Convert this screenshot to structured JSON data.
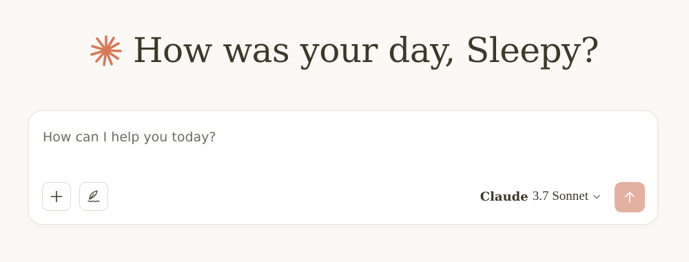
{
  "greeting": {
    "text": "How was your day, Sleepy?",
    "icon": "claude-spark-icon",
    "icon_color": "#d97757"
  },
  "composer": {
    "placeholder": "How can I help you today?",
    "value": "",
    "add_button_icon": "plus-icon",
    "style_button_icon": "quill-pen-icon",
    "model": {
      "name": "Claude",
      "version": "3.7 Sonnet",
      "dropdown_icon": "chevron-down-icon"
    },
    "send_button_icon": "arrow-up-icon",
    "send_button_color": "#e4b19f"
  },
  "colors": {
    "background": "#faf9f5",
    "text": "#3d3929",
    "accent": "#d97757"
  }
}
